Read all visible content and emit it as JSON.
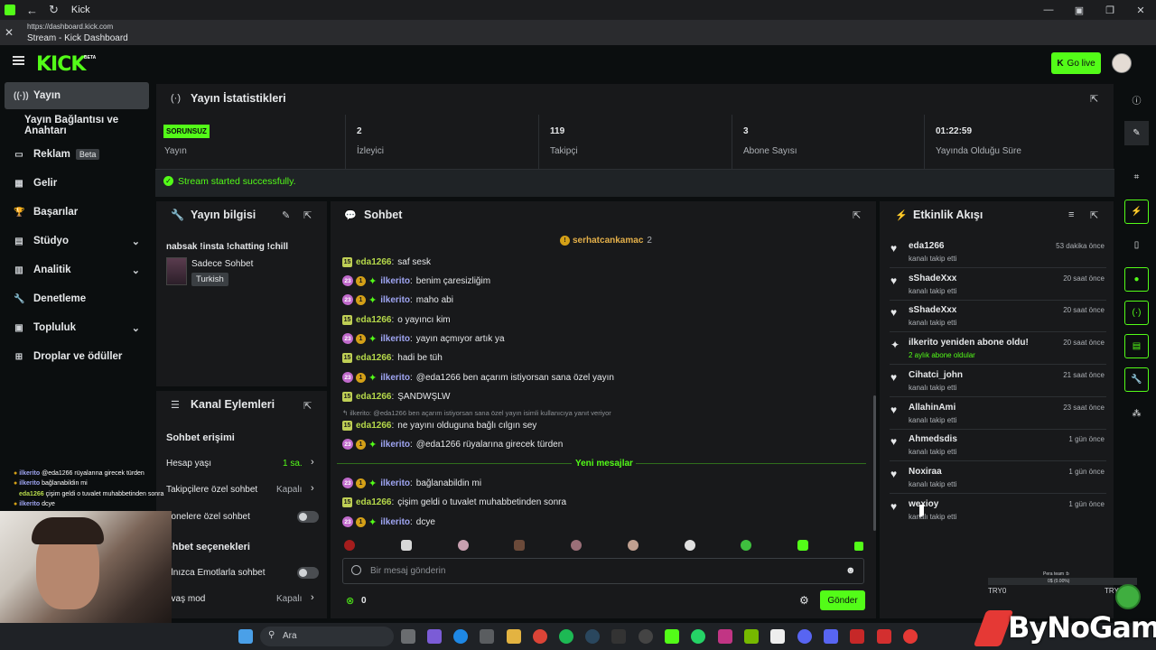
{
  "browser": {
    "tab_title": "Kick",
    "url": "https://dashboard.kick.com",
    "page_title": "Stream - Kick Dashboard"
  },
  "header": {
    "logo": "KICK",
    "logo_badge": "BETA",
    "go_live": "Go live"
  },
  "sidebar": {
    "items": [
      {
        "label": "Yayın",
        "icon": "broadcast-icon"
      },
      {
        "label": "Yayın Bağlantısı ve Anahtarı",
        "icon": ""
      },
      {
        "label": "Reklam",
        "icon": "ad-icon",
        "badge": "Beta"
      },
      {
        "label": "Gelir",
        "icon": "grid-icon"
      },
      {
        "label": "Başarılar",
        "icon": "trophy-icon"
      },
      {
        "label": "Stüdyo",
        "icon": "studio-icon"
      },
      {
        "label": "Analitik",
        "icon": "chart-icon"
      },
      {
        "label": "Denetleme",
        "icon": "wrench-icon"
      },
      {
        "label": "Topluluk",
        "icon": "community-icon"
      },
      {
        "label": "Droplar ve ödüller",
        "icon": "gift-icon"
      }
    ]
  },
  "stats": {
    "title": "Yayın İstatistikleri",
    "status_badge": "SORUNSUZ",
    "status_label": "Yayın",
    "cells": [
      {
        "value": "2",
        "label": "İzleyici"
      },
      {
        "value": "119",
        "label": "Takipçi"
      },
      {
        "value": "3",
        "label": "Abone Sayısı"
      },
      {
        "value": "01:22:59",
        "label": "Yayında Olduğu Süre"
      }
    ],
    "success_message": "Stream started successfully."
  },
  "stream_info": {
    "title": "Yayın bilgisi",
    "stream_title": "nabsak !insta !chatting !chill",
    "category": "Sadece Sohbet",
    "tag": "Turkish"
  },
  "channel_actions": {
    "title": "Kanal Eylemleri",
    "chat_access_heading": "Sohbet erişimi",
    "account_age_label": "Hesap yaşı",
    "account_age_value": "1 sa.",
    "followers_only_label": "Takipçilere özel sohbet",
    "followers_only_value": "Kapalı",
    "subscribers_only_label": "oonelere özel sohbet",
    "chat_options_heading": "ohbet seçenekleri",
    "emote_only_label": "alnızca Emotlarla sohbet",
    "slow_mode_label": "avaş mod",
    "slow_mode_value": "Kapalı"
  },
  "chat": {
    "title": "Sohbet",
    "pinned_user": "serhatcankamac",
    "pinned_count": "2",
    "reply_context": "ilkerito: @eda1266 ben açarım istiyorsan sana özel yayın isimli kullanıcıya yanıt veriyor",
    "new_messages_divider": "Yeni mesajlar",
    "messages_before": [
      {
        "user": "eda1266",
        "type": "eda",
        "text": "saf sesk"
      },
      {
        "user": "ilkerito",
        "type": "ilk",
        "text": "benim çaresizliğim"
      },
      {
        "user": "ilkerito",
        "type": "ilk",
        "text": "maho abi"
      },
      {
        "user": "eda1266",
        "type": "eda",
        "text": "o yayıncı kim"
      },
      {
        "user": "ilkerito",
        "type": "ilk",
        "text": "yayın açmıyor artık ya"
      },
      {
        "user": "eda1266",
        "type": "eda",
        "text": "hadi be tüh"
      },
      {
        "user": "ilkerito",
        "type": "ilk",
        "text": "@eda1266 ben açarım istiyorsan sana özel yayın"
      },
      {
        "user": "eda1266",
        "type": "eda",
        "text": "ŞANDWŞLW"
      },
      {
        "user": "eda1266",
        "type": "eda",
        "text": "ne yayını olduguna bağlı cılgın sey"
      },
      {
        "user": "ilkerito",
        "type": "ilk",
        "text": "@eda1266 rüyalarına girecek türden"
      }
    ],
    "messages_after": [
      {
        "user": "ilkerito",
        "type": "ilk",
        "text": "bağlanabildin mi"
      },
      {
        "user": "eda1266",
        "type": "eda",
        "text": "çişim geldi o tuvalet muhabbetinden sonra"
      },
      {
        "user": "ilkerito",
        "type": "ilk",
        "text": "dcye"
      }
    ],
    "badge_sub_eda": "15",
    "badge_sub_ilk": "23",
    "badge_gift": "1",
    "input_placeholder": "Bir mesaj gönderin",
    "points": "0",
    "send_button": "Gönder"
  },
  "activity": {
    "title": "Etkinlik Akışı",
    "items": [
      {
        "name": "eda1266",
        "sub": "kanalı takip etti",
        "time": "53 dakika önce",
        "icon": "heart-icon"
      },
      {
        "name": "sShadeXxx",
        "sub": "kanalı takip etti",
        "time": "20 saat önce",
        "icon": "heart-icon"
      },
      {
        "name": "sShadeXxx",
        "sub": "kanalı takip etti",
        "time": "20 saat önce",
        "icon": "heart-icon"
      },
      {
        "name": "ilkerito yeniden abone oldu!",
        "sub": "2 aylık abone oldular",
        "time": "20 saat önce",
        "icon": "sparkle-icon"
      },
      {
        "name": "Cihatci_john",
        "sub": "kanalı takip etti",
        "time": "21 saat önce",
        "icon": "heart-icon"
      },
      {
        "name": "AllahinAmi",
        "sub": "kanalı takip etti",
        "time": "23 saat önce",
        "icon": "heart-icon"
      },
      {
        "name": "Ahmedsdis",
        "sub": "kanalı takip etti",
        "time": "1 gün önce",
        "icon": "heart-icon"
      },
      {
        "name": "Noxiraa",
        "sub": "kanalı takip etti",
        "time": "1 gün önce",
        "icon": "heart-icon"
      },
      {
        "name": "wexioy",
        "sub": "kanalı takip etti",
        "time": "1 gün önce",
        "icon": "heart-icon"
      }
    ]
  },
  "overlay": {
    "chat_lines": [
      {
        "user": "ilkerito",
        "text": "@eda1266 rüyalarına girecek türden"
      },
      {
        "user": "ilkerito",
        "text": "bağlanabildin mi"
      },
      {
        "user": "eda1266",
        "text": "çişim geldi o tuvalet muhabbetinden sonra"
      },
      {
        "user": "ilkerito",
        "text": "dcye"
      }
    ],
    "progress_title": "Pera team :b",
    "progress_text": "0$ (0.00%)",
    "progress_fraction": 0.0,
    "progress_left": "TRY0",
    "progress_right": "TRY5",
    "watermark": "ByNoGame"
  },
  "taskbar": {
    "search_placeholder": "Ara"
  },
  "colors": {
    "accent": "#53fc18",
    "panel": "#18191b",
    "background": "#0b0e0f"
  }
}
